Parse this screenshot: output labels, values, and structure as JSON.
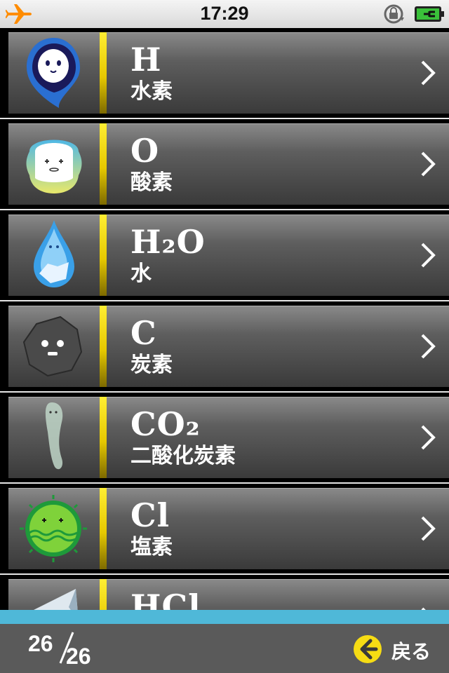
{
  "status_bar": {
    "time": "17:29"
  },
  "list": {
    "items": [
      {
        "formula": "H",
        "name": "水素",
        "icon": "hydrogen-mascot-icon"
      },
      {
        "formula": "O",
        "name": "酸素",
        "icon": "oxygen-mascot-icon"
      },
      {
        "formula": "H₂O",
        "name": "水",
        "icon": "water-drop-mascot-icon"
      },
      {
        "formula": "C",
        "name": "炭素",
        "icon": "carbon-rock-mascot-icon"
      },
      {
        "formula": "CO₂",
        "name": "二酸化炭素",
        "icon": "carbon-dioxide-ghost-icon"
      },
      {
        "formula": "Cl",
        "name": "塩素",
        "icon": "chlorine-mascot-icon"
      },
      {
        "formula": "HCl",
        "name": "",
        "icon": "hydrogen-chloride-icon"
      }
    ]
  },
  "toolbar": {
    "page_current": "26",
    "page_total": "26",
    "back_label": "戻る"
  },
  "colors": {
    "accent_bar": "#4fb8d8",
    "yellow_divider": "#ffee33",
    "toolbar_bg": "#5a5a5a"
  }
}
